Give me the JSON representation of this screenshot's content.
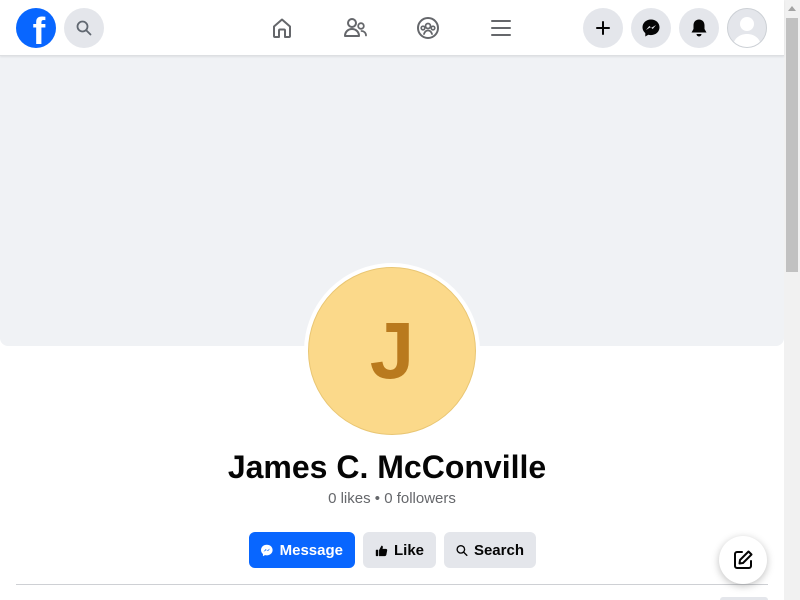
{
  "topbar": {
    "logo_letter": "f",
    "icons": {
      "search": "search-icon",
      "home": "home-icon",
      "friends": "friends-icon",
      "groups": "groups-icon",
      "menu": "menu-icon",
      "create": "plus-icon",
      "messenger": "messenger-icon",
      "notifications": "bell-icon",
      "account": "avatar-icon"
    }
  },
  "profile": {
    "initial": "J",
    "name": "James C. McConville",
    "stats": "0 likes • 0 followers"
  },
  "actions": {
    "message_label": "Message",
    "like_label": "Like",
    "search_label": "Search"
  },
  "colors": {
    "brand_blue": "#0866ff",
    "avatar_bg": "#fbd98a",
    "avatar_initial": "#b97a1e",
    "cover_bg": "#f0f2f5"
  }
}
